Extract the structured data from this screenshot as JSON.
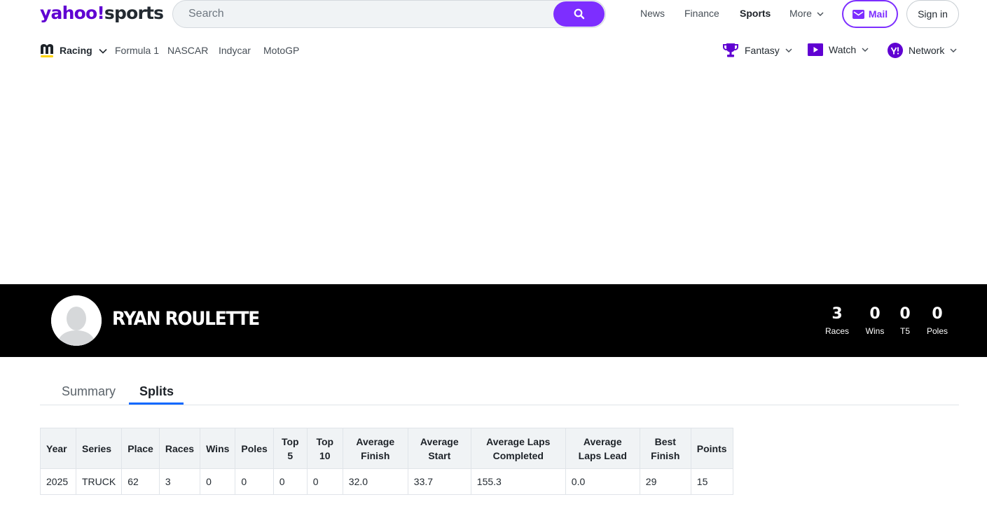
{
  "header": {
    "logo_prefix": "yahoo!",
    "logo_suffix": "sports",
    "search_placeholder": "Search",
    "nav": [
      "News",
      "Finance",
      "Sports",
      "More"
    ],
    "mail_label": "Mail",
    "signin_label": "Sign in"
  },
  "subnav": {
    "racing_label": "Racing",
    "links": [
      "Formula 1",
      "NASCAR",
      "Indycar",
      "MotoGP"
    ],
    "fantasy_label": "Fantasy",
    "watch_label": "Watch",
    "network_label": "Network"
  },
  "driver": {
    "name": "RYAN ROULETTE",
    "stats": [
      {
        "value": "3",
        "label": "Races"
      },
      {
        "value": "0",
        "label": "Wins"
      },
      {
        "value": "0",
        "label": "T5"
      },
      {
        "value": "0",
        "label": "Poles"
      }
    ]
  },
  "tabs": [
    "Summary",
    "Splits"
  ],
  "active_tab": "Splits",
  "table": {
    "headers": [
      "Year",
      "Series",
      "Place",
      "Races",
      "Wins",
      "Poles",
      "Top 5",
      "Top 10",
      "Average Finish",
      "Average Start",
      "Average Laps Completed",
      "Average Laps Lead",
      "Best Finish",
      "Points"
    ],
    "rows": [
      [
        "2025",
        "TRUCK",
        "62",
        "3",
        "0",
        "0",
        "0",
        "0",
        "32.0",
        "33.7",
        "155.3",
        "0.0",
        "29",
        "15"
      ]
    ]
  },
  "colors": {
    "brand_purple": "#6001d2",
    "accent_purple": "#7d2eff",
    "banner_black": "#000000",
    "tab_underline": "#0f69ff"
  }
}
